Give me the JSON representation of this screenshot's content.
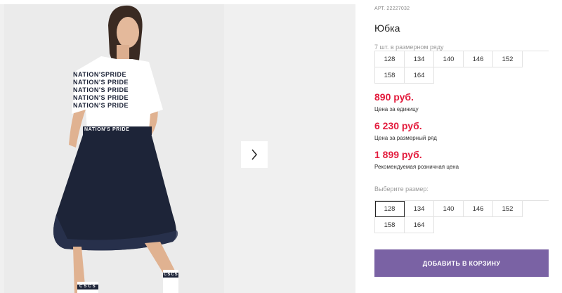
{
  "product": {
    "article": "АРТ. 22227032",
    "title": "Юбка",
    "count_in_range": "7 шт. в размерном ряду",
    "range_sizes": [
      "128",
      "134",
      "140",
      "146",
      "152",
      "158",
      "164"
    ],
    "prices": [
      {
        "value": "890 руб.",
        "note": "Цена за единицу"
      },
      {
        "value": "6 230 руб.",
        "note": "Цена за размерный ряд"
      },
      {
        "value": "1 899 руб.",
        "note": "Рекомендуемая розничная цена"
      }
    ],
    "choose_label": "Выберите размер:",
    "choose_sizes": [
      "128",
      "134",
      "140",
      "146",
      "152",
      "158",
      "164"
    ],
    "selected_size": "128",
    "add_to_cart": "ДОБАВИТЬ В КОРЗИНУ"
  },
  "photo": {
    "shirt_text_lines": [
      "NATION'SPRIDE",
      "NATION'S PRIDE",
      "NATION'S PRIDE",
      "NATION'S PRIDE",
      "NATION'S PRIDE"
    ],
    "waistband_text": "NATION'S PRIDE",
    "sock_text": "CSCS"
  },
  "colors": {
    "price": "#e31c3d",
    "button": "#7a62a4",
    "skirt": "#1d2438"
  },
  "icons": {
    "next": "chevron-right-icon"
  }
}
